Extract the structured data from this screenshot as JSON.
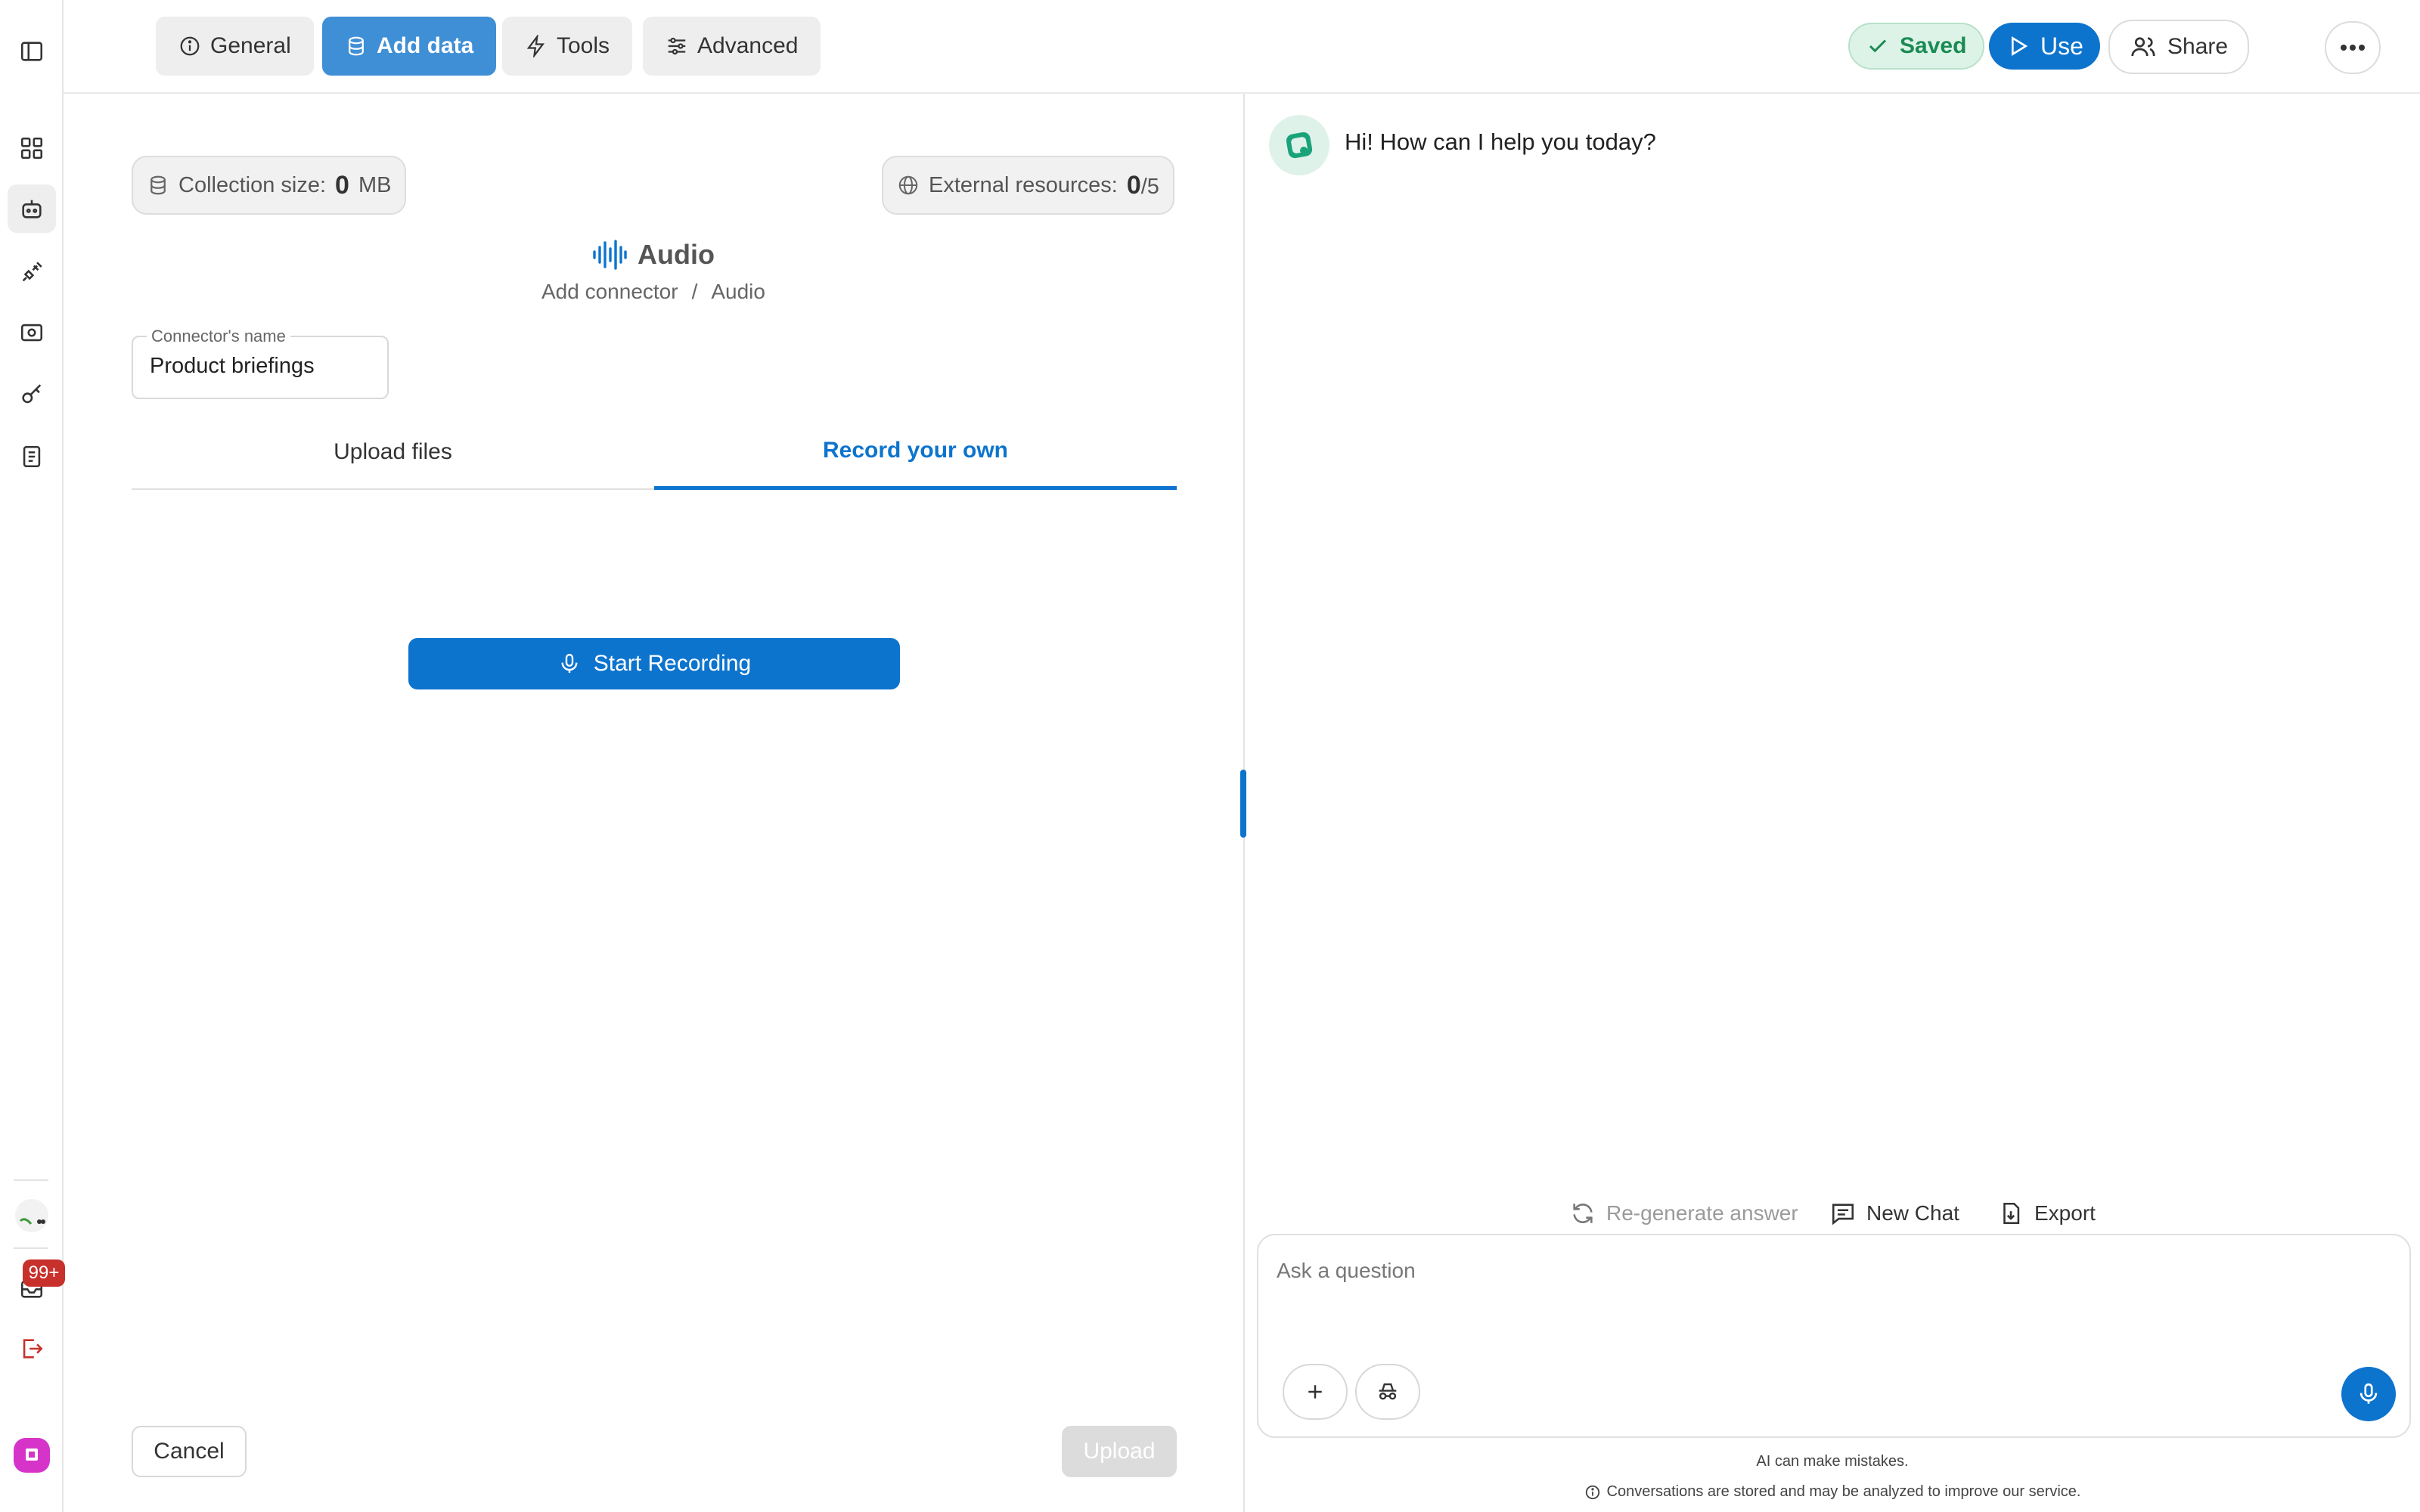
{
  "top_tabs": [
    {
      "label": "General",
      "icon": "info-icon"
    },
    {
      "label": "Add data",
      "icon": "database-icon",
      "active": true
    },
    {
      "label": "Tools",
      "icon": "bolt-icon"
    },
    {
      "label": "Advanced",
      "icon": "sliders-icon"
    }
  ],
  "header_actions": {
    "saved_label": "Saved",
    "use_label": "Use",
    "share_label": "Share"
  },
  "rail": {
    "badge_count": "99+"
  },
  "stats": {
    "collection_label": "Collection size:",
    "collection_value": "0",
    "collection_unit": "MB",
    "external_label": "External resources:",
    "external_value": "0",
    "external_max": "/5"
  },
  "connector": {
    "title": "Audio",
    "breadcrumb_parent": "Add connector",
    "breadcrumb_sep": "/",
    "breadcrumb_current": "Audio",
    "name_label": "Connector's name",
    "name_value": "Product briefings"
  },
  "source_tabs": {
    "upload_label": "Upload files",
    "record_label": "Record your own",
    "active": "record"
  },
  "record_button": "Start Recording",
  "footer": {
    "cancel_label": "Cancel",
    "upload_label": "Upload"
  },
  "chat": {
    "greeting": "Hi! How can I help you today?",
    "regenerate_label": "Re-generate answer",
    "new_chat_label": "New Chat",
    "export_label": "Export",
    "input_placeholder": "Ask a question",
    "disclaimer_1": "AI can make mistakes.",
    "disclaimer_2": "Conversations are stored and may be analyzed to improve our service."
  },
  "colors": {
    "primary": "#0d74ce",
    "primary_light": "#3f8fd6",
    "saved_green": "#1a8b54",
    "badge_red": "#c8302b",
    "app_logo": "#d633c9"
  }
}
